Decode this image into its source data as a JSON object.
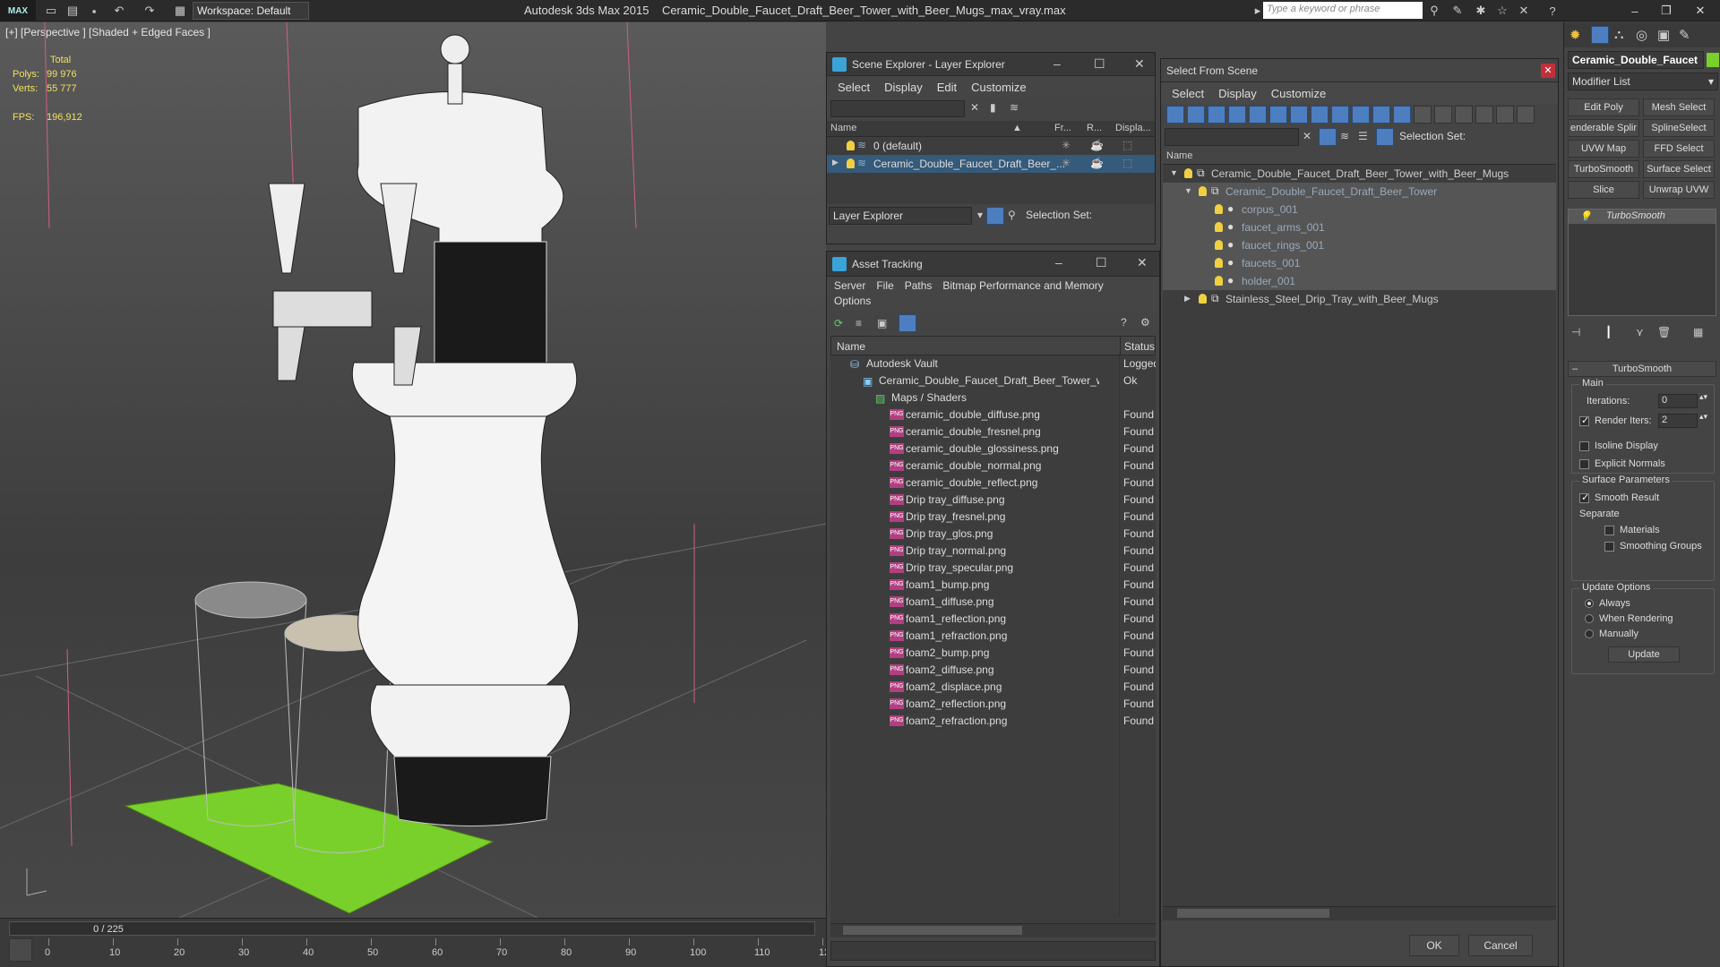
{
  "app": {
    "logo": "MAX",
    "title": "Autodesk 3ds Max  2015",
    "file": "Ceramic_Double_Faucet_Draft_Beer_Tower_with_Beer_Mugs_max_vray.max",
    "workspace": "Workspace: Default",
    "search_placeholder": "Type a keyword or phrase"
  },
  "viewport": {
    "label": "[+] [Perspective ] [Shaded + Edged Faces ]",
    "stats": {
      "total_label": "Total",
      "polys_label": "Polys:",
      "polys": "99 976",
      "verts_label": "Verts:",
      "verts": "55 777",
      "fps_label": "FPS:",
      "fps": "196,912"
    }
  },
  "timeline": {
    "frame": "0 / 225",
    "ticks": [
      "0",
      "10",
      "20",
      "30",
      "40",
      "50",
      "60",
      "70",
      "80",
      "90",
      "100",
      "110",
      "12"
    ]
  },
  "scene_explorer": {
    "title": "Scene Explorer - Layer Explorer",
    "menu": [
      "Select",
      "Display",
      "Edit",
      "Customize"
    ],
    "columns": [
      "Name",
      "Fr...",
      "R...",
      "Displa..."
    ],
    "rows": [
      {
        "label": "0 (default)",
        "selected": false
      },
      {
        "label": "Ceramic_Double_Faucet_Draft_Beer_...",
        "selected": true
      }
    ],
    "footer_dropdown": "Layer Explorer",
    "footer_label": "Selection Set:"
  },
  "asset_tracking": {
    "title": "Asset Tracking",
    "menu": [
      "Server",
      "File",
      "Paths",
      "Bitmap Performance and Memory"
    ],
    "menu2": "Options",
    "columns": [
      "Name",
      "Status"
    ],
    "rows": [
      {
        "name": "Autodesk Vault",
        "status": "Logged",
        "level": 1,
        "icon": "vault"
      },
      {
        "name": "Ceramic_Double_Faucet_Draft_Beer_Tower_with...",
        "status": "Ok",
        "level": 2,
        "icon": "max"
      },
      {
        "name": "Maps / Shaders",
        "status": "",
        "level": 3,
        "icon": "folder"
      },
      {
        "name": "ceramic_double_diffuse.png",
        "status": "Found",
        "level": 4,
        "icon": "png"
      },
      {
        "name": "ceramic_double_fresnel.png",
        "status": "Found",
        "level": 4,
        "icon": "png"
      },
      {
        "name": "ceramic_double_glossiness.png",
        "status": "Found",
        "level": 4,
        "icon": "png"
      },
      {
        "name": "ceramic_double_normal.png",
        "status": "Found",
        "level": 4,
        "icon": "png"
      },
      {
        "name": "ceramic_double_reflect.png",
        "status": "Found",
        "level": 4,
        "icon": "png"
      },
      {
        "name": "Drip tray_diffuse.png",
        "status": "Found",
        "level": 4,
        "icon": "png"
      },
      {
        "name": "Drip tray_fresnel.png",
        "status": "Found",
        "level": 4,
        "icon": "png"
      },
      {
        "name": "Drip tray_glos.png",
        "status": "Found",
        "level": 4,
        "icon": "png"
      },
      {
        "name": "Drip tray_normal.png",
        "status": "Found",
        "level": 4,
        "icon": "png"
      },
      {
        "name": "Drip tray_specular.png",
        "status": "Found",
        "level": 4,
        "icon": "png"
      },
      {
        "name": "foam1_bump.png",
        "status": "Found",
        "level": 4,
        "icon": "png"
      },
      {
        "name": "foam1_diffuse.png",
        "status": "Found",
        "level": 4,
        "icon": "png"
      },
      {
        "name": "foam1_reflection.png",
        "status": "Found",
        "level": 4,
        "icon": "png"
      },
      {
        "name": "foam1_refraction.png",
        "status": "Found",
        "level": 4,
        "icon": "png"
      },
      {
        "name": "foam2_bump.png",
        "status": "Found",
        "level": 4,
        "icon": "png"
      },
      {
        "name": "foam2_diffuse.png",
        "status": "Found",
        "level": 4,
        "icon": "png"
      },
      {
        "name": "foam2_displace.png",
        "status": "Found",
        "level": 4,
        "icon": "png"
      },
      {
        "name": "foam2_reflection.png",
        "status": "Found",
        "level": 4,
        "icon": "png"
      },
      {
        "name": "foam2_refraction.png",
        "status": "Found",
        "level": 4,
        "icon": "png"
      }
    ]
  },
  "select_from_scene": {
    "title": "Select From Scene",
    "menu": [
      "Select",
      "Display",
      "Customize"
    ],
    "selection_set_label": "Selection Set:",
    "column": "Name",
    "rows": [
      {
        "label": "Ceramic_Double_Faucet_Draft_Beer_Tower_with_Beer_Mugs",
        "level": 0,
        "expand": "▼"
      },
      {
        "label": "Ceramic_Double_Faucet_Draft_Beer_Tower",
        "level": 1,
        "expand": "▼"
      },
      {
        "label": "corpus_001",
        "level": 2,
        "expand": ""
      },
      {
        "label": "faucet_arms_001",
        "level": 2,
        "expand": ""
      },
      {
        "label": "faucet_rings_001",
        "level": 2,
        "expand": ""
      },
      {
        "label": "faucets_001",
        "level": 2,
        "expand": ""
      },
      {
        "label": "holder_001",
        "level": 2,
        "expand": ""
      },
      {
        "label": "Stainless_Steel_Drip_Tray_with_Beer_Mugs",
        "level": 1,
        "expand": "▶"
      }
    ],
    "ok": "OK",
    "cancel": "Cancel"
  },
  "command_panel": {
    "object_name": "Ceramic_Double_Faucet",
    "modifier_list": "Modifier List",
    "buttons": [
      "Edit Poly",
      "Mesh Select",
      "enderable Splir",
      "SplineSelect",
      "UVW Map",
      "FFD Select",
      "TurboSmooth",
      "Surface Select",
      "Slice",
      "Unwrap UVW"
    ],
    "stack_item": "TurboSmooth",
    "rollout": "TurboSmooth",
    "main": "Main",
    "iterations_label": "Iterations:",
    "iterations": "0",
    "render_iters_label": "Render Iters:",
    "render_iters": "2",
    "isoline": "Isoline Display",
    "explicit": "Explicit Normals",
    "surface_params": "Surface Parameters",
    "smooth_result": "Smooth Result",
    "separate": "Separate",
    "materials": "Materials",
    "smoothing_groups": "Smoothing Groups",
    "update_options": "Update Options",
    "always": "Always",
    "when_rendering": "When Rendering",
    "manually": "Manually",
    "update": "Update"
  },
  "colors": {
    "accent": "#3aa3d8",
    "selected": "#355a7a",
    "stats": "#f0e060",
    "tray": "#7ad02a"
  }
}
